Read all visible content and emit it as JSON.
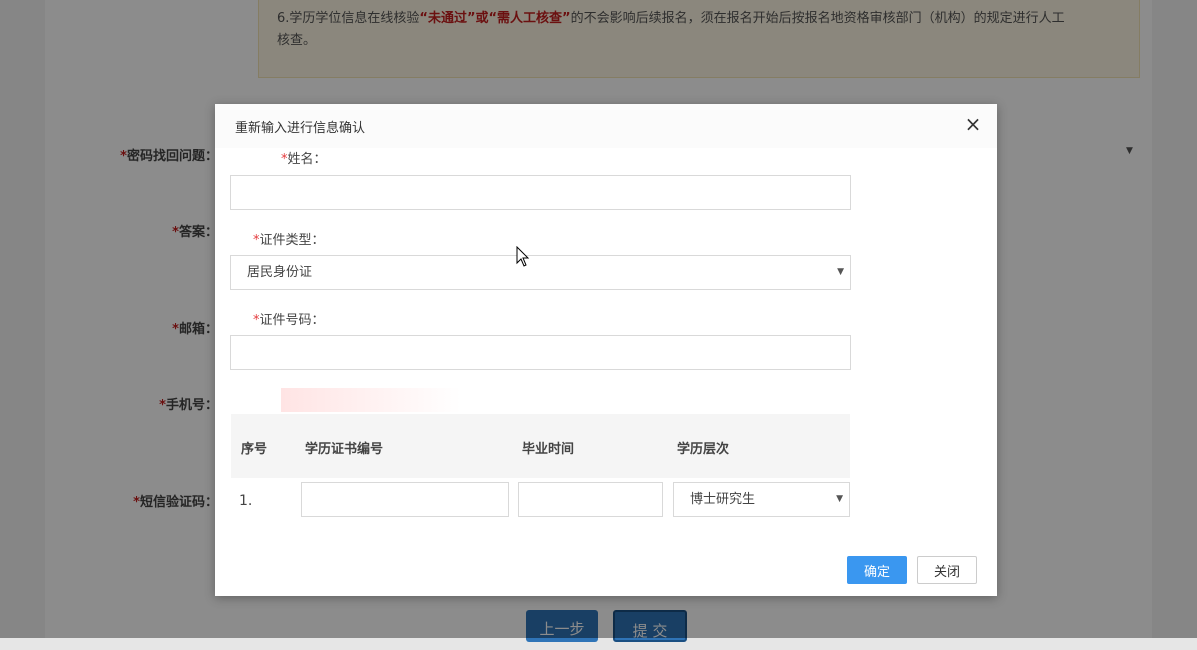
{
  "background": {
    "notice": {
      "prefix": "6.学历学位信息在线核验",
      "highlight": "“未通过”或“需人工核查”",
      "suffix_line1": "的不会影响后续报名，须在报名开始后按报名地资格审核部门（机构）的规定进行人工",
      "line2": "核查。"
    },
    "labels": [
      {
        "key": "question",
        "text": "密码找回问题："
      },
      {
        "key": "answer",
        "text": "答案："
      },
      {
        "key": "email",
        "text": "邮箱："
      },
      {
        "key": "phone",
        "text": "手机号："
      },
      {
        "key": "sms",
        "text": "短信验证码："
      }
    ],
    "buttons": {
      "prev": "上一步",
      "submit": "提 交"
    }
  },
  "modal": {
    "title": "重新输入进行信息确认",
    "fields": {
      "name": {
        "label": "姓名：",
        "value": "",
        "placeholder": ""
      },
      "id_type": {
        "label": "证件类型：",
        "value": "居民身份证"
      },
      "id_number": {
        "label": "证件号码：",
        "value": "",
        "placeholder": ""
      }
    },
    "table": {
      "headers": [
        "序号",
        "学历证书编号",
        "毕业时间",
        "学历层次"
      ],
      "rows": [
        {
          "no": "1.",
          "cert_no": "",
          "grad_time": "",
          "level": "博士研究生"
        }
      ]
    },
    "buttons": {
      "ok": "确定",
      "close": "关闭"
    }
  }
}
